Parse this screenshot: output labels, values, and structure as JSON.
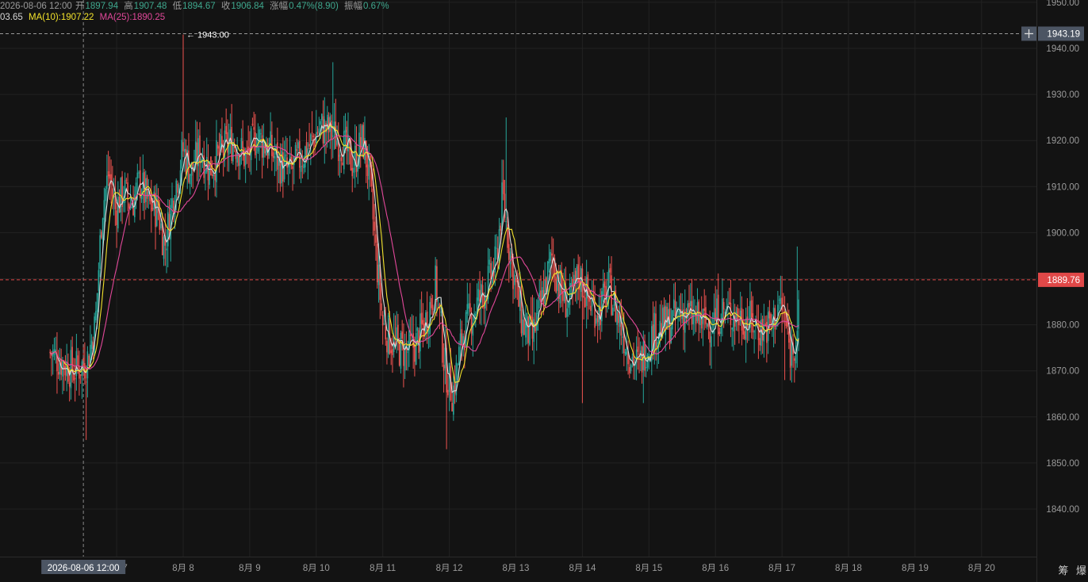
{
  "header": {
    "ohlc": {
      "date": "2026-08-06 12:00",
      "open_label": "开",
      "open": "1897.94",
      "high_label": "高",
      "high": "1907.48",
      "low_label": "低",
      "low": "1894.67",
      "close_label": "收",
      "close": "1906.84",
      "change_label": "涨幅",
      "change": "0.47%(8.90)",
      "amplitude_label": "振幅",
      "amplitude": "0.67%"
    },
    "ma": {
      "ma5_partial": "03.65",
      "ma10": "MA(10):1907.22",
      "ma25": "MA(25):1890.25"
    }
  },
  "price_axis": {
    "crosshair_price": "1943.19",
    "current_price": "1889.76",
    "plus_icon": "plus-icon"
  },
  "annotations": {
    "high_marker": "1943.00",
    "crosshair_time": "2026-08-06 12:00"
  },
  "tools": {
    "chips_label": "筹",
    "liquidation_label": "爆"
  },
  "colors": {
    "up": "#26a69a",
    "down": "#ef5350",
    "ma_white": "#dcdcdc",
    "ma_yellow": "#f2e22c",
    "ma_magenta": "#e2489a",
    "current_price": "#e04848",
    "crosshair_badge": "#4c5563"
  },
  "chart_data": {
    "type": "candlestick",
    "y_ticks": [
      1950,
      1940,
      1930,
      1920,
      1910,
      1900,
      1890,
      1880,
      1870,
      1860,
      1850,
      1840
    ],
    "ylim": [
      1831.6,
      1951.5
    ],
    "x_tick_labels": [
      "8月 7",
      "8月 8",
      "8月 9",
      "8月 10",
      "8月 11",
      "8月 12",
      "8月 13",
      "8月 14",
      "8月 15",
      "8月 16",
      "8月 17",
      "8月 18",
      "8月 19",
      "8月 20"
    ],
    "x_tick_days": [
      7,
      8,
      9,
      10,
      11,
      12,
      13,
      14,
      15,
      16,
      17,
      18,
      19,
      20
    ],
    "candle_minutes": 30,
    "start_day": 6.0,
    "series": [
      {
        "name": "MA(10)",
        "color": "#f2e22c"
      },
      {
        "name": "MA(25)",
        "color": "#e2489a"
      }
    ],
    "anchors": [
      [
        6.0,
        1874
      ],
      [
        6.35,
        1870
      ],
      [
        6.55,
        1872
      ],
      [
        6.68,
        1880
      ],
      [
        6.78,
        1905
      ],
      [
        6.88,
        1913
      ],
      [
        6.98,
        1905
      ],
      [
        7.1,
        1909
      ],
      [
        7.22,
        1906
      ],
      [
        7.35,
        1911
      ],
      [
        7.48,
        1906
      ],
      [
        7.62,
        1905
      ],
      [
        7.72,
        1897
      ],
      [
        7.85,
        1908
      ],
      [
        8.0,
        1918
      ],
      [
        8.12,
        1913
      ],
      [
        8.25,
        1918
      ],
      [
        8.4,
        1914
      ],
      [
        8.55,
        1917
      ],
      [
        8.75,
        1920
      ],
      [
        8.95,
        1916
      ],
      [
        9.1,
        1921
      ],
      [
        9.3,
        1918
      ],
      [
        9.45,
        1915
      ],
      [
        9.6,
        1913
      ],
      [
        9.75,
        1916
      ],
      [
        9.9,
        1919
      ],
      [
        10.05,
        1923
      ],
      [
        10.2,
        1922
      ],
      [
        10.4,
        1919
      ],
      [
        10.55,
        1915
      ],
      [
        10.7,
        1920
      ],
      [
        10.8,
        1912
      ],
      [
        10.9,
        1895
      ],
      [
        11.0,
        1880
      ],
      [
        11.15,
        1876
      ],
      [
        11.35,
        1874
      ],
      [
        11.5,
        1876
      ],
      [
        11.65,
        1881
      ],
      [
        11.8,
        1889
      ],
      [
        11.93,
        1871
      ],
      [
        12.05,
        1865
      ],
      [
        12.2,
        1878
      ],
      [
        12.4,
        1884
      ],
      [
        12.55,
        1888
      ],
      [
        12.7,
        1893
      ],
      [
        12.8,
        1908
      ],
      [
        12.9,
        1897
      ],
      [
        13.0,
        1888
      ],
      [
        13.1,
        1880
      ],
      [
        13.25,
        1877
      ],
      [
        13.4,
        1886
      ],
      [
        13.55,
        1895
      ],
      [
        13.65,
        1888
      ],
      [
        13.8,
        1884
      ],
      [
        13.95,
        1891
      ],
      [
        14.1,
        1885
      ],
      [
        14.25,
        1883
      ],
      [
        14.4,
        1888
      ],
      [
        14.55,
        1881
      ],
      [
        14.7,
        1874
      ],
      [
        14.85,
        1871
      ],
      [
        14.95,
        1875
      ],
      [
        15.1,
        1879
      ],
      [
        15.3,
        1880
      ],
      [
        15.5,
        1883
      ],
      [
        15.7,
        1881
      ],
      [
        15.9,
        1880
      ],
      [
        16.1,
        1883
      ],
      [
        16.3,
        1882
      ],
      [
        16.5,
        1881
      ],
      [
        16.7,
        1879
      ],
      [
        16.85,
        1880
      ],
      [
        16.95,
        1885
      ],
      [
        17.05,
        1881
      ],
      [
        17.12,
        1874
      ],
      [
        17.2,
        1877
      ],
      [
        17.25,
        1882
      ]
    ]
  }
}
